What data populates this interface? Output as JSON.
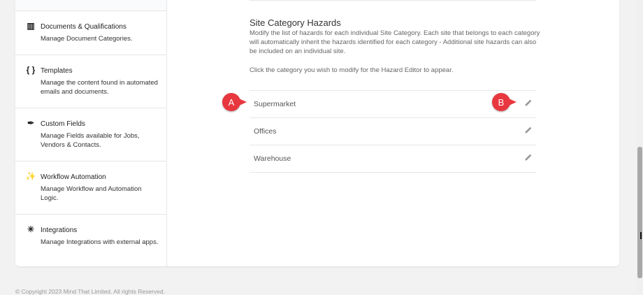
{
  "sidebar": {
    "items": [
      {
        "icon": "library-books-icon",
        "glyph": "▥",
        "title": "Documents & Qualifications",
        "desc": "Manage Document Categories."
      },
      {
        "icon": "code-braces-icon",
        "glyph": "{ }",
        "title": "Templates",
        "desc": "Manage the content found in automated emails and documents."
      },
      {
        "icon": "feather-icon",
        "glyph": "✒",
        "title": "Custom Fields",
        "desc": "Manage Fields available for Jobs, Vendors & Contacts."
      },
      {
        "icon": "magic-wand-icon",
        "glyph": "✨",
        "title": "Workflow Automation",
        "desc": "Manage Workflow and Automation Logic."
      },
      {
        "icon": "integration-nodes-icon",
        "glyph": "✳",
        "title": "Integrations",
        "desc": "Manage Integrations with external apps."
      }
    ]
  },
  "main": {
    "title": "Site Category Hazards",
    "description": "Modify the list of hazards for each individual Site Category. Each site that belongs to each category will automatically inherit the hazards identified for each category - Additional site hazards can also be included on an individual site.",
    "hint": "Click the category you wish to modify for the Hazard Editor to appear.",
    "categories": [
      {
        "name": "Supermarket"
      },
      {
        "name": "Offices"
      },
      {
        "name": "Warehouse"
      }
    ]
  },
  "annotations": {
    "a": "A",
    "b": "B",
    "color": "#e8373f"
  },
  "footer": "© Copyright 2023 Mind That Limited. All rights Reserved."
}
